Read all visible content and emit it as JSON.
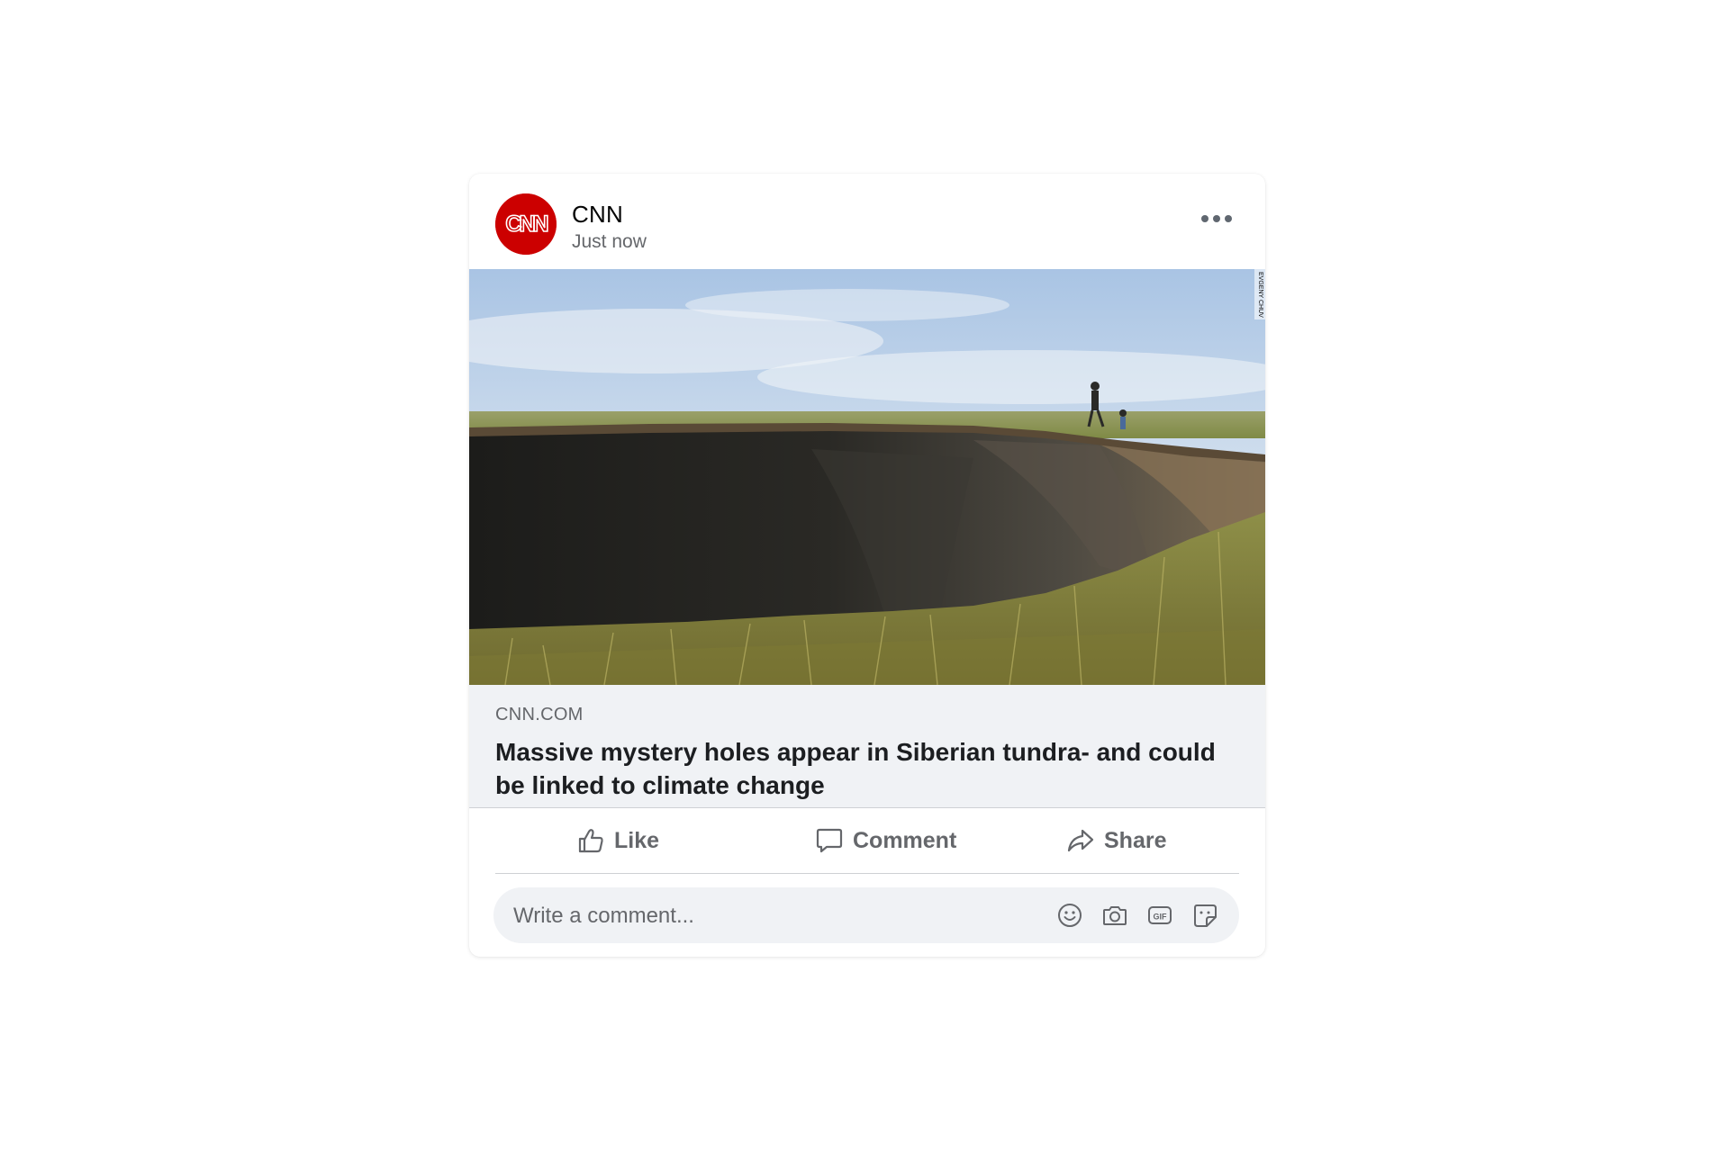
{
  "post": {
    "author": "CNN",
    "avatar_text": "CNN",
    "timestamp": "Just now",
    "more_icon": "more-horizontal-icon",
    "image_alt": "Large crater in Siberian tundra with people standing at the edge",
    "photo_credit": "EVGENY CHUV"
  },
  "link_preview": {
    "domain": "CNN.COM",
    "title": "Massive mystery holes appear in Siberian tundra- and could be linked to climate change"
  },
  "actions": {
    "like_label": "Like",
    "comment_label": "Comment",
    "share_label": "Share"
  },
  "comment_box": {
    "placeholder": "Write a comment...",
    "icons": [
      "emoji-icon",
      "camera-icon",
      "gif-icon",
      "sticker-icon"
    ]
  },
  "colors": {
    "brand_red": "#cc0000",
    "secondary_text": "#65676b",
    "preview_bg": "#f0f2f5",
    "divider": "#ced0d4"
  }
}
